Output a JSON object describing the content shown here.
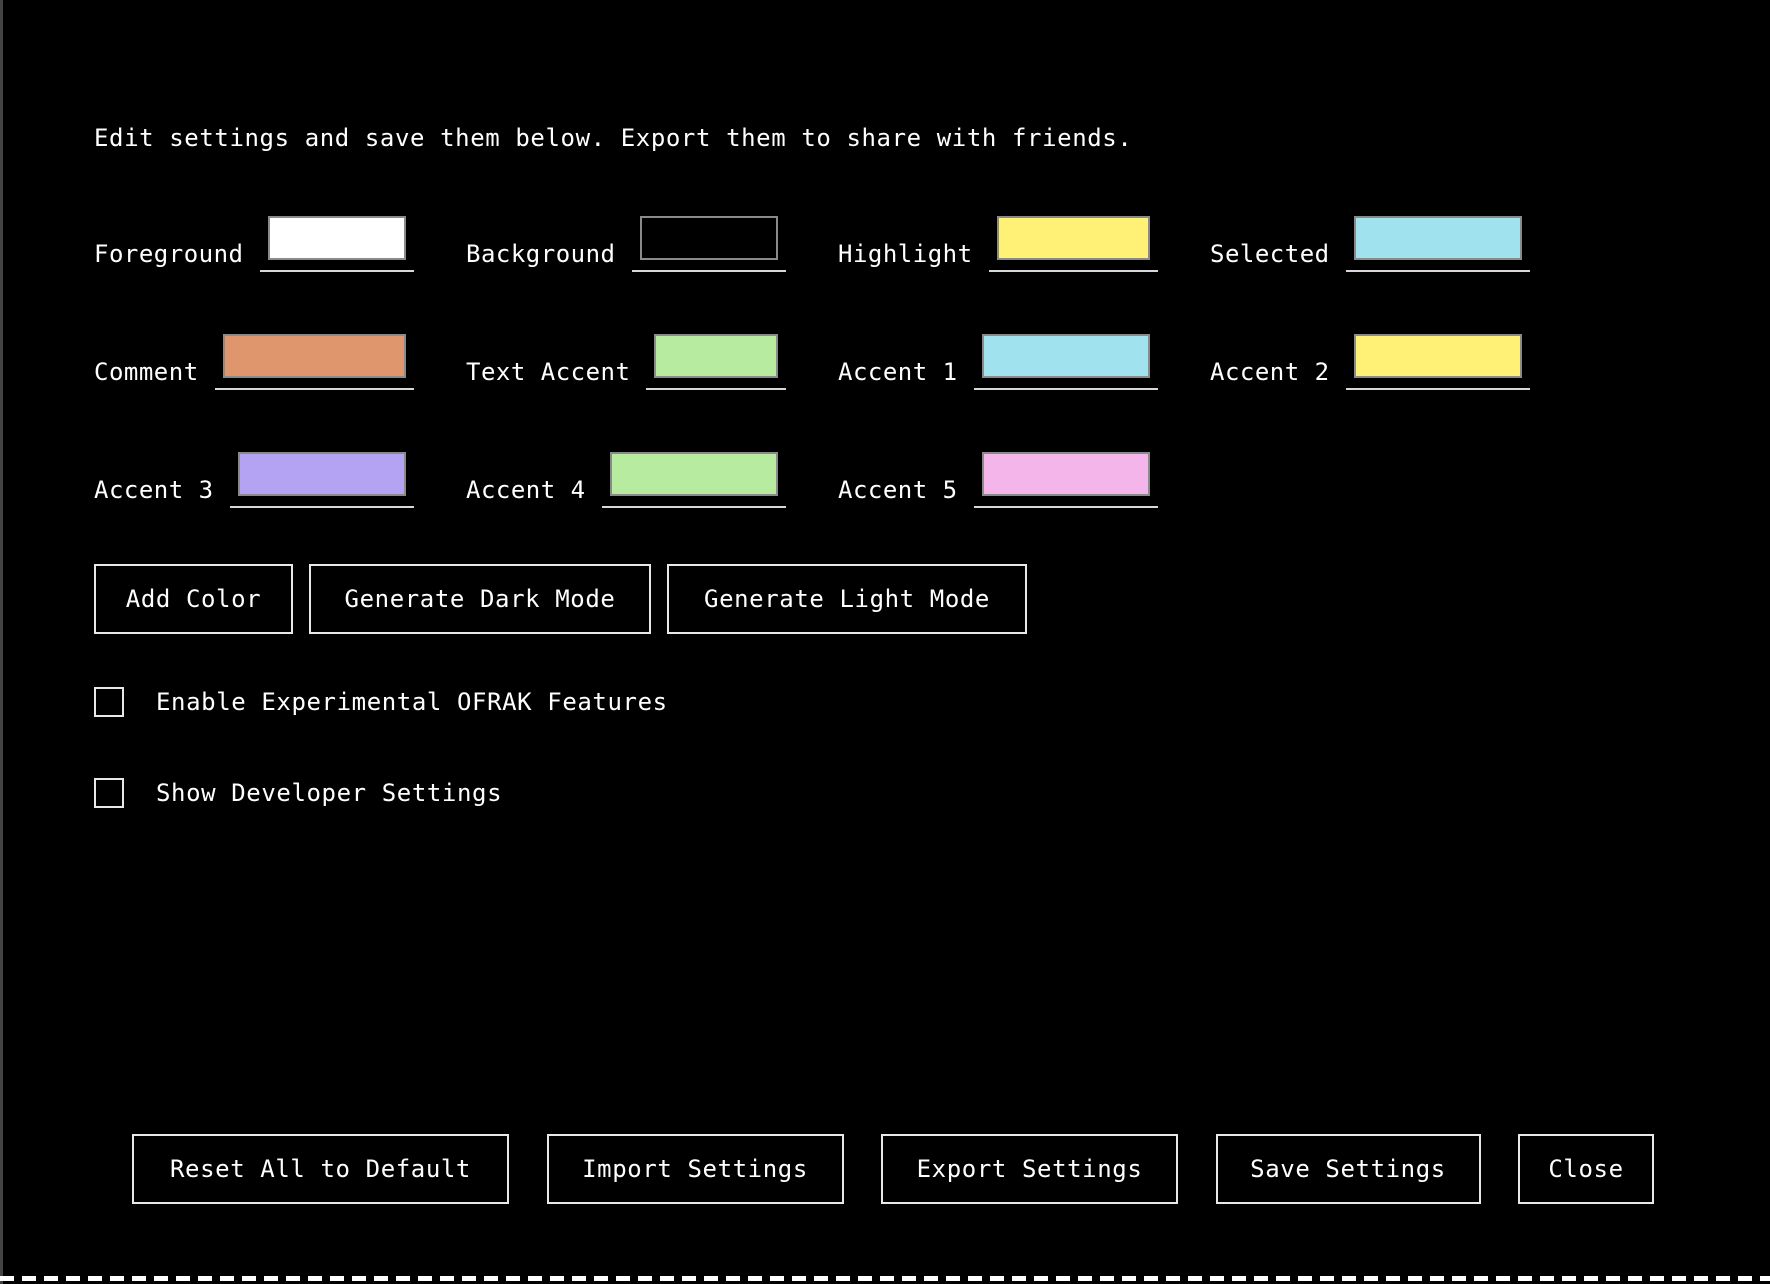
{
  "intro_text": "Edit settings and save them below. Export them to share with friends.",
  "colors": [
    {
      "label": "Foreground",
      "value": "#ffffff"
    },
    {
      "label": "Background",
      "value": "#000000"
    },
    {
      "label": "Highlight",
      "value": "#fff176"
    },
    {
      "label": "Selected",
      "value": "#a0e3ee"
    },
    {
      "label": "Comment",
      "value": "#e0966c"
    },
    {
      "label": "Text Accent",
      "value": "#b7eca0"
    },
    {
      "label": "Accent 1",
      "value": "#a0e3ee"
    },
    {
      "label": "Accent 2",
      "value": "#fff176"
    },
    {
      "label": "Accent 3",
      "value": "#b4a3f2"
    },
    {
      "label": "Accent 4",
      "value": "#b7eca0"
    },
    {
      "label": "Accent 5",
      "value": "#f3b5ea"
    }
  ],
  "actions": {
    "add_color": "Add Color",
    "generate_dark": "Generate Dark Mode",
    "generate_light": "Generate Light Mode"
  },
  "checkboxes": {
    "experimental": {
      "label": "Enable Experimental OFRAK Features",
      "checked": false
    },
    "developer": {
      "label": "Show Developer Settings",
      "checked": false
    }
  },
  "footer": {
    "reset": "Reset All to Default",
    "import": "Import Settings",
    "export": "Export Settings",
    "save": "Save Settings",
    "close": "Close"
  }
}
